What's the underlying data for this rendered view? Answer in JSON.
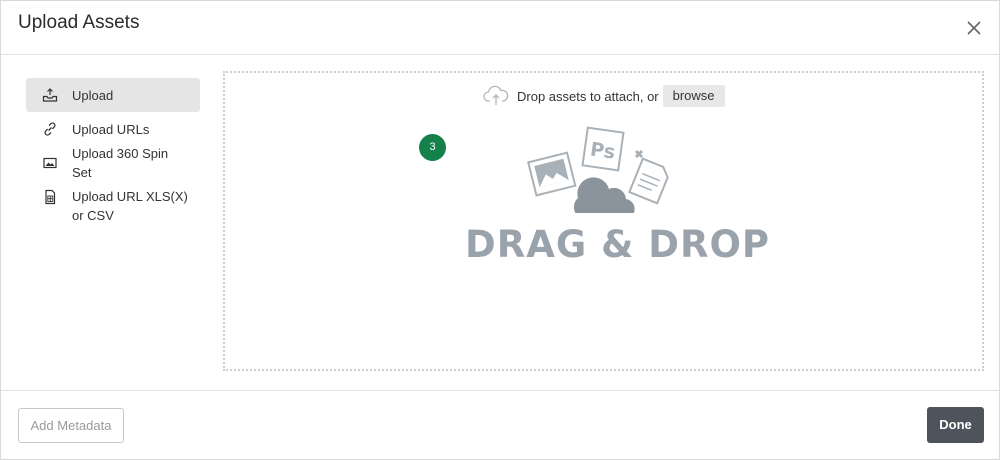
{
  "dialog": {
    "title": "Upload Assets",
    "close_icon": "close-icon"
  },
  "sidebar": {
    "items": [
      {
        "label": "Upload",
        "icon": "upload-tray-icon",
        "active": true
      },
      {
        "label": "Upload URLs",
        "icon": "link-icon",
        "active": false
      },
      {
        "label": "Upload 360 Spin Set",
        "icon": "image-icon",
        "active": false
      },
      {
        "label": "Upload URL XLS(X) or CSV",
        "icon": "spreadsheet-icon",
        "active": false
      }
    ]
  },
  "dropzone": {
    "text": "Drop assets to attach, or",
    "browse_label": "browse",
    "cloud_icon": "cloud-upload-icon",
    "badge_count": "3",
    "illustration_text": "DRAG & DROP",
    "illustration_icons": [
      "photo-icon",
      "photoshop-icon",
      "document-icon",
      "cloud-upload-icon"
    ]
  },
  "footer": {
    "add_metadata_label": "Add Metadata",
    "done_label": "Done"
  },
  "colors": {
    "badge": "#14804a",
    "done_button": "#4e545c",
    "illustration": "#9aa3ab",
    "active_item": "#e5e5e5"
  }
}
